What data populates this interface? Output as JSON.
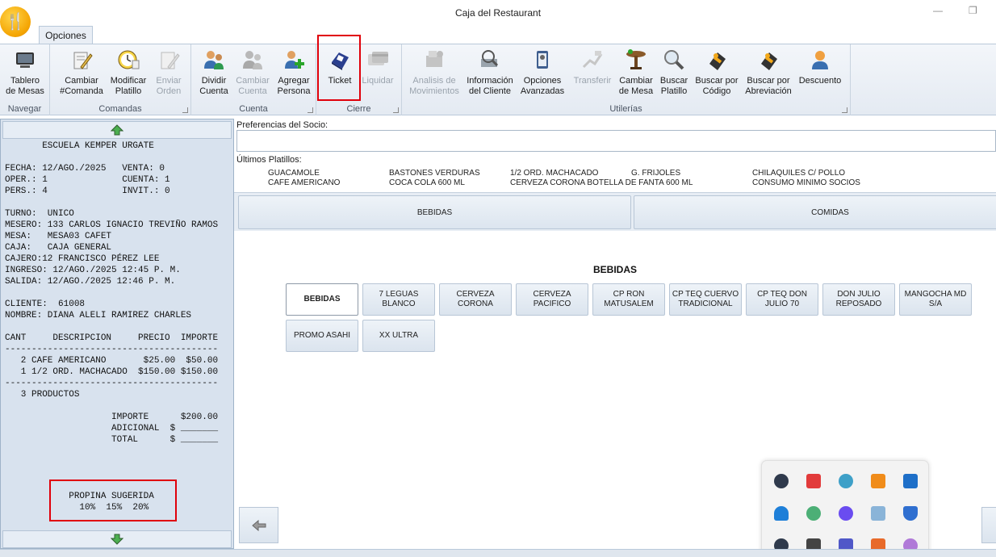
{
  "window": {
    "title": "Caja del Restaurant"
  },
  "ribbon": {
    "tab": "Opciones",
    "groups": {
      "navegar": "Navegar",
      "comandas": "Comandas",
      "cuenta": "Cuenta",
      "cierre": "Cierre",
      "utilerias": "Utilerías"
    },
    "buttons": {
      "tablero": [
        "Tablero",
        "de Mesas"
      ],
      "cambiar_comanda": [
        "Cambiar",
        "#Comanda"
      ],
      "modificar_platillo": [
        "Modificar",
        "Platillo"
      ],
      "enviar_orden": [
        "Enviar",
        "Orden"
      ],
      "dividir_cuenta": [
        "Dividir",
        "Cuenta"
      ],
      "cambiar_cuenta": [
        "Cambiar",
        "Cuenta"
      ],
      "agregar_persona": [
        "Agregar",
        "Persona"
      ],
      "ticket": "Ticket",
      "liquidar": "Liquidar",
      "analisis": [
        "Analisis de",
        "Movimientos"
      ],
      "info_cliente": [
        "Información",
        "del Cliente"
      ],
      "opciones_avanzadas": [
        "Opciones",
        "Avanzadas"
      ],
      "transferir": "Transferir",
      "cambiar_mesa": [
        "Cambiar",
        "de Mesa"
      ],
      "buscar_platillo": [
        "Buscar",
        "Platillo"
      ],
      "buscar_codigo": [
        "Buscar por",
        "Código"
      ],
      "buscar_abreviacion": [
        "Buscar por",
        "Abreviación"
      ],
      "descuento": "Descuento"
    }
  },
  "receipt": {
    "lines": [
      "       ESCUELA KEMPER URGATE",
      "",
      "FECHA: 12/AGO./2025   VENTA: 0",
      "OPER.: 1              CUENTA: 1",
      "PERS.: 4              INVIT.: 0",
      "",
      "TURNO:  UNICO",
      "MESERO: 133 CARLOS IGNACIO TREVIÑO RAMOS",
      "MESA:   MESA03 CAFET",
      "CAJA:   CAJA GENERAL",
      "CAJERO:12 FRANCISCO PÉREZ LEE",
      "INGRESO: 12/AGO./2025 12:45 P. M.",
      "SALIDA: 12/AGO./2025 12:46 P. M.",
      "",
      "CLIENTE:  61008",
      "NOMBRE: DIANA ALELI RAMIREZ CHARLES",
      "",
      "CANT     DESCRIPCION     PRECIO  IMPORTE",
      "----------------------------------------",
      "   2 CAFE AMERICANO       $25.00  $50.00",
      "   1 1/2 ORD. MACHACADO  $150.00 $150.00",
      "----------------------------------------",
      "   3 PRODUCTOS",
      "",
      "                    IMPORTE      $200.00",
      "                    ADICIONAL  $ _______",
      "                    TOTAL      $ _______",
      "",
      "",
      "",
      "",
      "            PROPINA SUGERIDA",
      "              10%  15%  20%"
    ]
  },
  "main": {
    "preferencias_label": "Preferencias del Socio:",
    "ultimos_label": "Últimos Platillos:",
    "ultimos": [
      "GUACAMOLE",
      "CAFE AMERICANO",
      "BASTONES VERDURAS",
      "COCA COLA 600 ML",
      "1/2 ORD. MACHACADO",
      "CERVEZA CORONA BOTELLA DE FANTA 600 ML",
      "G. FRIJOLES",
      "CHILAQUILES C/ POLLO",
      "CONSUMO MINIMO SOCIOS"
    ],
    "categories": [
      "BEBIDAS",
      "COMIDAS"
    ],
    "subcategory_title": "BEBIDAS",
    "items": [
      [
        "BEBIDAS"
      ],
      [
        "7 LEGUAS",
        "BLANCO"
      ],
      [
        "CERVEZA",
        "CORONA"
      ],
      [
        "CERVEZA",
        "PACIFICO"
      ],
      [
        "CP RON",
        "MATUSALEM"
      ],
      [
        "CP TEQ CUERVO",
        "TRADICIONAL"
      ],
      [
        "CP TEQ DON",
        "JULIO 70"
      ],
      [
        "DON JULIO",
        "REPOSADO"
      ],
      [
        "MANGOCHA MD",
        "S/A"
      ],
      [
        "PROMO ASAHI"
      ],
      [
        "XX ULTRA"
      ]
    ]
  },
  "colors": {
    "highlight": "#e0000a",
    "panel": "#d8e2ee"
  }
}
